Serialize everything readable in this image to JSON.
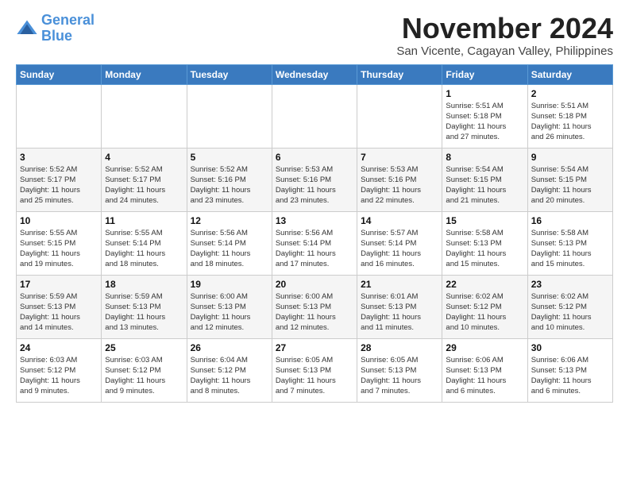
{
  "logo": {
    "line1": "General",
    "line2": "Blue"
  },
  "title": "November 2024",
  "subtitle": "San Vicente, Cagayan Valley, Philippines",
  "days_of_week": [
    "Sunday",
    "Monday",
    "Tuesday",
    "Wednesday",
    "Thursday",
    "Friday",
    "Saturday"
  ],
  "weeks": [
    [
      {
        "day": "",
        "detail": ""
      },
      {
        "day": "",
        "detail": ""
      },
      {
        "day": "",
        "detail": ""
      },
      {
        "day": "",
        "detail": ""
      },
      {
        "day": "",
        "detail": ""
      },
      {
        "day": "1",
        "detail": "Sunrise: 5:51 AM\nSunset: 5:18 PM\nDaylight: 11 hours\nand 27 minutes."
      },
      {
        "day": "2",
        "detail": "Sunrise: 5:51 AM\nSunset: 5:18 PM\nDaylight: 11 hours\nand 26 minutes."
      }
    ],
    [
      {
        "day": "3",
        "detail": "Sunrise: 5:52 AM\nSunset: 5:17 PM\nDaylight: 11 hours\nand 25 minutes."
      },
      {
        "day": "4",
        "detail": "Sunrise: 5:52 AM\nSunset: 5:17 PM\nDaylight: 11 hours\nand 24 minutes."
      },
      {
        "day": "5",
        "detail": "Sunrise: 5:52 AM\nSunset: 5:16 PM\nDaylight: 11 hours\nand 23 minutes."
      },
      {
        "day": "6",
        "detail": "Sunrise: 5:53 AM\nSunset: 5:16 PM\nDaylight: 11 hours\nand 23 minutes."
      },
      {
        "day": "7",
        "detail": "Sunrise: 5:53 AM\nSunset: 5:16 PM\nDaylight: 11 hours\nand 22 minutes."
      },
      {
        "day": "8",
        "detail": "Sunrise: 5:54 AM\nSunset: 5:15 PM\nDaylight: 11 hours\nand 21 minutes."
      },
      {
        "day": "9",
        "detail": "Sunrise: 5:54 AM\nSunset: 5:15 PM\nDaylight: 11 hours\nand 20 minutes."
      }
    ],
    [
      {
        "day": "10",
        "detail": "Sunrise: 5:55 AM\nSunset: 5:15 PM\nDaylight: 11 hours\nand 19 minutes."
      },
      {
        "day": "11",
        "detail": "Sunrise: 5:55 AM\nSunset: 5:14 PM\nDaylight: 11 hours\nand 18 minutes."
      },
      {
        "day": "12",
        "detail": "Sunrise: 5:56 AM\nSunset: 5:14 PM\nDaylight: 11 hours\nand 18 minutes."
      },
      {
        "day": "13",
        "detail": "Sunrise: 5:56 AM\nSunset: 5:14 PM\nDaylight: 11 hours\nand 17 minutes."
      },
      {
        "day": "14",
        "detail": "Sunrise: 5:57 AM\nSunset: 5:14 PM\nDaylight: 11 hours\nand 16 minutes."
      },
      {
        "day": "15",
        "detail": "Sunrise: 5:58 AM\nSunset: 5:13 PM\nDaylight: 11 hours\nand 15 minutes."
      },
      {
        "day": "16",
        "detail": "Sunrise: 5:58 AM\nSunset: 5:13 PM\nDaylight: 11 hours\nand 15 minutes."
      }
    ],
    [
      {
        "day": "17",
        "detail": "Sunrise: 5:59 AM\nSunset: 5:13 PM\nDaylight: 11 hours\nand 14 minutes."
      },
      {
        "day": "18",
        "detail": "Sunrise: 5:59 AM\nSunset: 5:13 PM\nDaylight: 11 hours\nand 13 minutes."
      },
      {
        "day": "19",
        "detail": "Sunrise: 6:00 AM\nSunset: 5:13 PM\nDaylight: 11 hours\nand 12 minutes."
      },
      {
        "day": "20",
        "detail": "Sunrise: 6:00 AM\nSunset: 5:13 PM\nDaylight: 11 hours\nand 12 minutes."
      },
      {
        "day": "21",
        "detail": "Sunrise: 6:01 AM\nSunset: 5:13 PM\nDaylight: 11 hours\nand 11 minutes."
      },
      {
        "day": "22",
        "detail": "Sunrise: 6:02 AM\nSunset: 5:12 PM\nDaylight: 11 hours\nand 10 minutes."
      },
      {
        "day": "23",
        "detail": "Sunrise: 6:02 AM\nSunset: 5:12 PM\nDaylight: 11 hours\nand 10 minutes."
      }
    ],
    [
      {
        "day": "24",
        "detail": "Sunrise: 6:03 AM\nSunset: 5:12 PM\nDaylight: 11 hours\nand 9 minutes."
      },
      {
        "day": "25",
        "detail": "Sunrise: 6:03 AM\nSunset: 5:12 PM\nDaylight: 11 hours\nand 9 minutes."
      },
      {
        "day": "26",
        "detail": "Sunrise: 6:04 AM\nSunset: 5:12 PM\nDaylight: 11 hours\nand 8 minutes."
      },
      {
        "day": "27",
        "detail": "Sunrise: 6:05 AM\nSunset: 5:13 PM\nDaylight: 11 hours\nand 7 minutes."
      },
      {
        "day": "28",
        "detail": "Sunrise: 6:05 AM\nSunset: 5:13 PM\nDaylight: 11 hours\nand 7 minutes."
      },
      {
        "day": "29",
        "detail": "Sunrise: 6:06 AM\nSunset: 5:13 PM\nDaylight: 11 hours\nand 6 minutes."
      },
      {
        "day": "30",
        "detail": "Sunrise: 6:06 AM\nSunset: 5:13 PM\nDaylight: 11 hours\nand 6 minutes."
      }
    ]
  ]
}
